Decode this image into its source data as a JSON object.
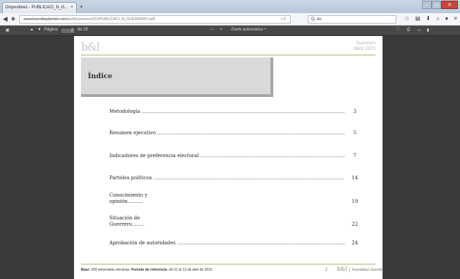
{
  "browser": {
    "tab_title": "Dispositive1 - PUBLICACI_N_G...",
    "tab_close": "×",
    "new_tab": "+",
    "url_domain": "www.buendiaylaredo.com",
    "url_path": "/publicaciones/310/PUBLICACI_N_GUERRERO.pdf",
    "url_reload": "▿ C",
    "search_text": "Q, au",
    "win_min": "–",
    "win_max": "▭",
    "win_close": "✕"
  },
  "pdf_toolbar": {
    "page_label": "Página:",
    "page_current": "2",
    "page_total": "de 25",
    "zoom_minus": "—",
    "zoom_plus": "+",
    "zoom_label": "Zoom automático ÷"
  },
  "document": {
    "logo": "b&l",
    "place": "Guerrero",
    "date": "Abril 2015",
    "index_title": "Índice",
    "toc": [
      {
        "label": "Metodología",
        "page": "3"
      },
      {
        "label": "Resumen ejecutivo",
        "page": "5"
      },
      {
        "label": "Indicadores de preferencia electoral",
        "page": "7"
      },
      {
        "label": "Partidos políticos",
        "page": "14"
      },
      {
        "label_line1": "Conocimiento y",
        "label_line2": "opinión",
        "page": "19"
      },
      {
        "label_line1": "Situación de",
        "label_line2": "Guerrero",
        "page": "22"
      },
      {
        "label": "Aprobación de autoridades",
        "page": "24"
      }
    ],
    "footer": {
      "base_label": "Base:",
      "base_text": " 600 entrevistas efectivas. ",
      "period_label": "Periodo de referencia:",
      "period_text": " del 11 al 13 de abril de 2015",
      "page_number": "2",
      "logo": "b&l",
      "brand_a": "buendía",
      "brand_amp": "&",
      "brand_b": "laredo"
    }
  },
  "colors": {
    "accent_line": "#a7b76a",
    "viewer_bg": "#3a3a3a"
  }
}
